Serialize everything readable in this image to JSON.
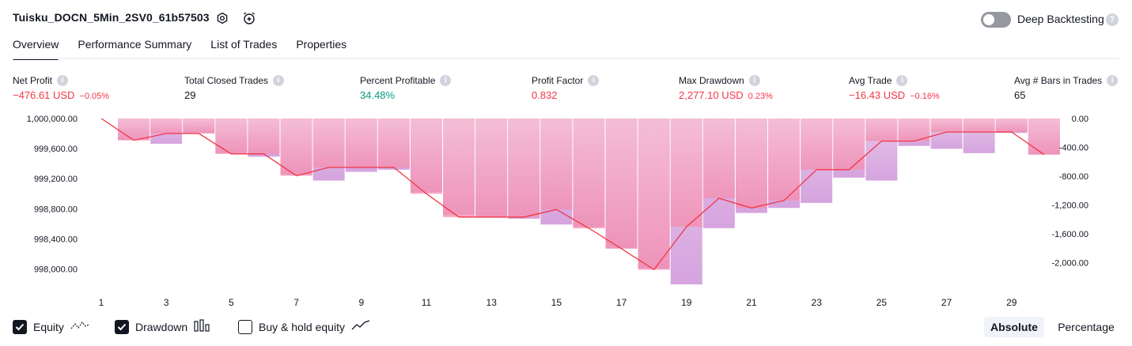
{
  "header": {
    "strategy_name": "Tuisku_DOCN_5Min_2SV0_61b57503",
    "settings_icon": "gear-icon",
    "alert_icon": "alarm-clock-plus-icon",
    "deep_backtesting_label": "Deep Backtesting",
    "deep_backtesting_enabled": false,
    "help_glyph": "?"
  },
  "tabs": [
    {
      "label": "Overview",
      "active": true
    },
    {
      "label": "Performance Summary",
      "active": false
    },
    {
      "label": "List of Trades",
      "active": false
    },
    {
      "label": "Properties",
      "active": false
    }
  ],
  "info_glyph": "i",
  "stats": [
    {
      "label": "Net Profit",
      "value": "−476.61 USD",
      "pct": "−0.05%",
      "tone": "neg"
    },
    {
      "label": "Total Closed Trades",
      "value": "29",
      "pct": "",
      "tone": "neutral"
    },
    {
      "label": "Percent Profitable",
      "value": "34.48%",
      "pct": "",
      "tone": "pos"
    },
    {
      "label": "Profit Factor",
      "value": "0.832",
      "pct": "",
      "tone": "neg"
    },
    {
      "label": "Max Drawdown",
      "value": "2,277.10 USD",
      "pct": "0.23%",
      "tone": "neg"
    },
    {
      "label": "Avg Trade",
      "value": "−16.43 USD",
      "pct": "−0.16%",
      "tone": "neg"
    },
    {
      "label": "Avg # Bars in Trades",
      "value": "65",
      "pct": "",
      "tone": "neutral"
    }
  ],
  "chart_data": {
    "type": "line",
    "x": [
      1,
      2,
      3,
      4,
      5,
      6,
      7,
      8,
      9,
      10,
      11,
      12,
      13,
      14,
      15,
      16,
      17,
      18,
      19,
      20,
      21,
      22,
      23,
      24,
      25,
      26,
      27,
      28,
      29,
      30
    ],
    "x_tick_labels": [
      "1",
      "3",
      "5",
      "7",
      "9",
      "11",
      "13",
      "15",
      "17",
      "19",
      "21",
      "23",
      "25",
      "27",
      "29"
    ],
    "left_axis": {
      "ticks": [
        "1,000,000.00",
        "999,600.00",
        "999,200.00",
        "998,800.00",
        "998,400.00",
        "998,000.00"
      ],
      "range": [
        997900,
        1000000
      ]
    },
    "right_axis": {
      "ticks": [
        "0.00",
        "-400.00",
        "-800.00",
        "-1,200.00",
        "-1,600.00",
        "-2,000.00"
      ],
      "range": [
        -2300,
        0
      ]
    },
    "series": [
      {
        "name": "Equity",
        "color": "#f23645",
        "values": [
          1000000,
          999710,
          999800,
          999800,
          999530,
          999530,
          999240,
          999350,
          999350,
          999350,
          999000,
          998690,
          998690,
          998690,
          998790,
          998540,
          998270,
          997990,
          998560,
          998940,
          998810,
          998910,
          999320,
          999320,
          999700,
          999700,
          999820,
          999820,
          999820,
          999520
        ]
      },
      {
        "name": "Drawdown",
        "color": "#c77dff",
        "values": [
          0,
          -300,
          -350,
          -200,
          -480,
          -530,
          -780,
          -860,
          -740,
          -710,
          -1020,
          -1330,
          -1370,
          -1390,
          -1470,
          -1500,
          -1800,
          -2080,
          -2300,
          -1520,
          -1310,
          -1240,
          -1170,
          -820,
          -860,
          -380,
          -420,
          -480,
          -200,
          -500
        ]
      }
    ]
  },
  "legend": [
    {
      "label": "Equity",
      "checked": true,
      "icon": "equity-line-icon"
    },
    {
      "label": "Drawdown",
      "checked": true,
      "icon": "drawdown-bars-icon"
    },
    {
      "label": "Buy & hold equity",
      "checked": false,
      "icon": "buy-hold-line-icon"
    }
  ],
  "scale_toggle": [
    {
      "label": "Absolute",
      "active": true
    },
    {
      "label": "Percentage",
      "active": false
    }
  ]
}
